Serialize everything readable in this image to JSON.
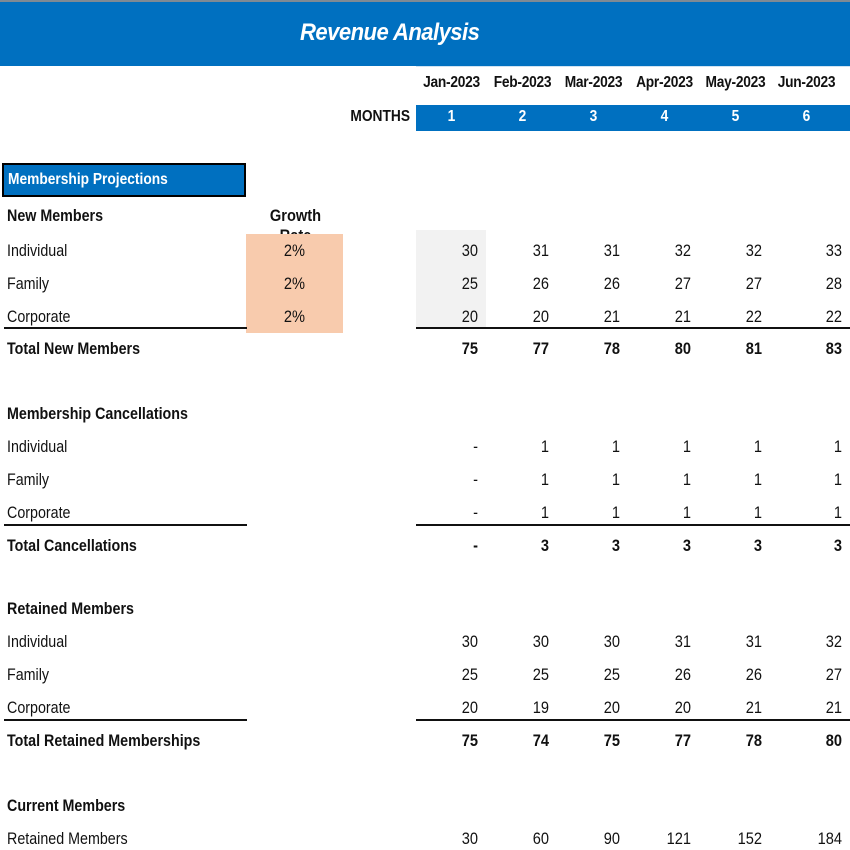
{
  "title": "Revenue Analysis",
  "months_label": "MONTHS",
  "month_dates": [
    "Jan-2023",
    "Feb-2023",
    "Mar-2023",
    "Apr-2023",
    "May-2023",
    "Jun-2023"
  ],
  "month_numbers": [
    "1",
    "2",
    "3",
    "4",
    "5",
    "6"
  ],
  "colors": {
    "header_blue": "#0070c0",
    "growth_input": "#f8cbad",
    "input_gray": "#f2f2f2"
  },
  "section_title": "Membership Projections",
  "growth_rate_header": "Growth Rate",
  "new_members": {
    "heading": "New Members",
    "rows": [
      {
        "label": "Individual",
        "growth": "2%",
        "values": [
          "30",
          "31",
          "31",
          "32",
          "32",
          "33"
        ]
      },
      {
        "label": "Family",
        "growth": "2%",
        "values": [
          "25",
          "26",
          "26",
          "27",
          "27",
          "28"
        ]
      },
      {
        "label": "Corporate",
        "growth": "2%",
        "values": [
          "20",
          "20",
          "21",
          "21",
          "22",
          "22"
        ]
      }
    ],
    "total": {
      "label": "Total New Members",
      "values": [
        "75",
        "77",
        "78",
        "80",
        "81",
        "83"
      ]
    }
  },
  "cancellations": {
    "heading": "Membership Cancellations",
    "rows": [
      {
        "label": "Individual",
        "values": [
          "-",
          "1",
          "1",
          "1",
          "1",
          "1"
        ]
      },
      {
        "label": "Family",
        "values": [
          "-",
          "1",
          "1",
          "1",
          "1",
          "1"
        ]
      },
      {
        "label": "Corporate",
        "values": [
          "-",
          "1",
          "1",
          "1",
          "1",
          "1"
        ]
      }
    ],
    "total": {
      "label": "Total Cancellations",
      "values": [
        "-",
        "3",
        "3",
        "3",
        "3",
        "3"
      ]
    }
  },
  "retained": {
    "heading": "Retained Members",
    "rows": [
      {
        "label": "Individual",
        "values": [
          "30",
          "30",
          "30",
          "31",
          "31",
          "32"
        ]
      },
      {
        "label": "Family",
        "values": [
          "25",
          "25",
          "25",
          "26",
          "26",
          "27"
        ]
      },
      {
        "label": "Corporate",
        "values": [
          "20",
          "19",
          "20",
          "20",
          "21",
          "21"
        ]
      }
    ],
    "total": {
      "label": "Total Retained Memberships",
      "values": [
        "75",
        "74",
        "75",
        "77",
        "78",
        "80"
      ]
    }
  },
  "current": {
    "heading": "Current Members",
    "rows": [
      {
        "label": "Retained Members",
        "values": [
          "30",
          "60",
          "90",
          "121",
          "152",
          "184"
        ]
      }
    ]
  }
}
